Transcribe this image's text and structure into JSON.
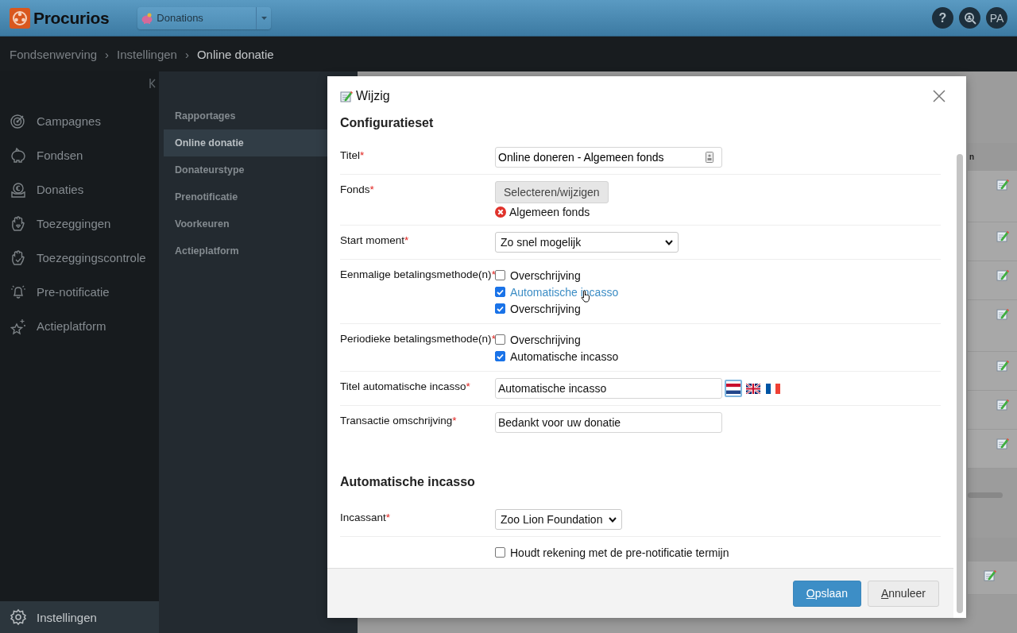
{
  "topbar": {
    "logo": "Procurios",
    "app_switcher": "Donations",
    "actions": [
      {
        "kind": "help",
        "text": "?"
      },
      {
        "kind": "search"
      },
      {
        "kind": "avatar",
        "text": "PA"
      }
    ]
  },
  "breadcrumb": [
    {
      "kind": "link",
      "text": "Fondsenwerving"
    },
    {
      "kind": "separator",
      "text": "›"
    },
    {
      "kind": "link",
      "text": "Instellingen"
    },
    {
      "kind": "separator",
      "text": "›"
    },
    {
      "kind": "current",
      "text": "Online donatie"
    }
  ],
  "sidebar": {
    "items": [
      {
        "label": "Campagnes",
        "selected": false
      },
      {
        "label": "Fondsen",
        "selected": false
      },
      {
        "label": "Donaties",
        "selected": false
      },
      {
        "label": "Toezeggingen",
        "selected": false
      },
      {
        "label": "Toezeggingscontrole",
        "selected": false
      },
      {
        "label": "Pre-notificatie",
        "selected": false
      },
      {
        "label": "Actieplatform",
        "selected": false
      }
    ],
    "footer_item": {
      "label": "Instellingen",
      "selected": true
    }
  },
  "subnav": [
    {
      "label": "Rapportages",
      "selected": false
    },
    {
      "label": "Online donatie",
      "selected": true
    },
    {
      "label": "Donateurstype",
      "selected": false
    },
    {
      "label": "Prenotificatie",
      "selected": false
    },
    {
      "label": "Voorkeuren",
      "selected": false
    },
    {
      "label": "Actieplatform",
      "selected": false
    }
  ],
  "background_table": {
    "column_3": "n"
  },
  "dialog": {
    "title": "Wijzig",
    "sections": [
      {
        "title": "Configuratieset",
        "fields": [
          {
            "kind": "lookup_text",
            "label": "Titel",
            "required_mark": "*",
            "value": "Online doneren - Algemeen fonds"
          },
          {
            "kind": "picker",
            "label": "Fonds",
            "required_mark": "*",
            "button": "Selecteren/wijzigen",
            "selection": "Algemeen fonds"
          },
          {
            "kind": "select",
            "label": "Start moment",
            "required_mark": "*",
            "value": "Zo snel mogelijk"
          },
          {
            "kind": "checkboxes",
            "label": "Eenmalige betalingsmethode(n)",
            "required_mark": "*",
            "options": [
              {
                "label": "Overschrijving",
                "checked": false,
                "hovered": false
              },
              {
                "label": "Automatische incasso",
                "checked": true,
                "hovered": true
              },
              {
                "label": "Overschrijving",
                "checked": true,
                "hovered": false
              }
            ]
          },
          {
            "kind": "checkboxes",
            "label": "Periodieke betalingsmethode(n)",
            "required_mark": "*",
            "options": [
              {
                "label": "Overschrijving",
                "checked": false,
                "hovered": false
              },
              {
                "label": "Automatische incasso",
                "checked": true,
                "hovered": false
              }
            ]
          },
          {
            "kind": "translated",
            "label": "Titel automatische incasso",
            "required_mark": "*",
            "value": "Automatische incasso",
            "languages": [
              {
                "kind": "nl",
                "selected": true
              },
              {
                "kind": "uk",
                "selected": false
              },
              {
                "kind": "fr",
                "selected": false
              }
            ]
          },
          {
            "kind": "text",
            "label": "Transactie omschrijving",
            "required_mark": "*",
            "value": "Bedankt voor uw donatie"
          }
        ]
      },
      {
        "title": "Automatische incasso",
        "fields": [
          {
            "kind": "select",
            "label": "Incassant",
            "required_mark": "*",
            "value": "Zoo Lion Foundation"
          },
          {
            "kind": "checkboxes",
            "options": [
              {
                "label": "Houdt rekening met de pre-notificatie termijn",
                "checked": false,
                "hovered": false
              }
            ]
          }
        ]
      }
    ],
    "buttons": [
      {
        "kind": "primary",
        "label": "Opslaan"
      },
      {
        "kind": "secondary",
        "label": "Annuleer"
      }
    ]
  }
}
